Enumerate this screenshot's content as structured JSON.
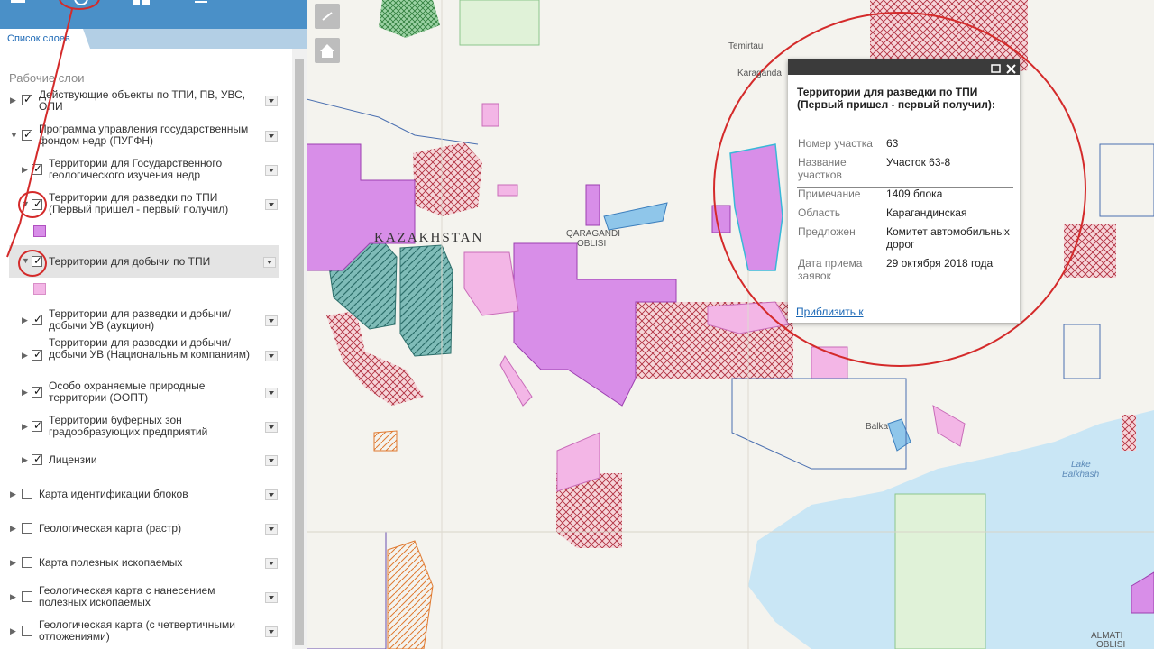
{
  "panel": {
    "tab_label": "Список слоев",
    "section_title": "Рабочие слои",
    "layers": [
      {
        "label": "Действующие объекты по ТПИ, ПВ, УВС, ОПИ",
        "checked": true
      },
      {
        "label": "Программа управления государственным фондом недр (ПУГФН)",
        "checked": true
      },
      {
        "label": "Территории для Государственного геологического изучения недр",
        "checked": true
      },
      {
        "label": "Территории для разведки по ТПИ (Первый пришел - первый получил)",
        "checked": true
      },
      {
        "label": "Территории для добычи по ТПИ",
        "checked": true
      },
      {
        "label": "Территории для разведки и добычи/ добычи УВ (аукцион)",
        "checked": true
      },
      {
        "label": "Территории для разведки и добычи/ добычи УВ (Национальным компаниям)",
        "checked": true
      },
      {
        "label": "Особо охраняемые природные территории (ООПТ)",
        "checked": true
      },
      {
        "label": "Территории буферных зон градообразующих предприятий",
        "checked": true
      },
      {
        "label": "Лицензии",
        "checked": true
      },
      {
        "label": "Карта идентификации блоков",
        "checked": false
      },
      {
        "label": "Геологическая карта (растр)",
        "checked": false
      },
      {
        "label": "Карта полезных ископаемых",
        "checked": false
      },
      {
        "label": "Геологическая карта с нанесением полезных ископаемых",
        "checked": false
      },
      {
        "label": "Геологическая карта (с четвертичными отложениями)",
        "checked": false
      }
    ]
  },
  "popup": {
    "title": "Территории для разведки по ТПИ (Первый пришел - первый получил):",
    "fields": [
      {
        "key": "Номер участка",
        "value": "63"
      },
      {
        "key": "Название участков",
        "value": "Участок 63-8"
      },
      {
        "key": "Примечание",
        "value": "1409 блока"
      },
      {
        "key": "Область",
        "value": "Карагандинская"
      },
      {
        "key": "Предложен",
        "value": "Комитет автомобильных дорог"
      },
      {
        "key": "Дата приема заявок",
        "value": "29 октября 2018 года"
      }
    ],
    "zoom_link": "Приблизить к"
  },
  "map": {
    "labels": {
      "kazakhstan": "KAZAKHSTAN",
      "qaragandi_1": "QARAGANDI",
      "qaragandi_2": "OBLISI",
      "temirtau": "Temirtau",
      "karaganda": "Karaganda",
      "balka": "Balka",
      "lake_1": "Lake",
      "lake_2": "Balkhash",
      "almati_1": "ALMATI",
      "almati_2": "OBLISI"
    }
  },
  "colors": {
    "topbar": "#4a90c8",
    "annotation_red": "#d42a2a",
    "tpi_fill": "#d88ee8",
    "extraction_fill": "#f3b6e6",
    "hatch_red": "#b03040",
    "green_hatch": "#3d8a86",
    "water": "#c9e6f5"
  }
}
